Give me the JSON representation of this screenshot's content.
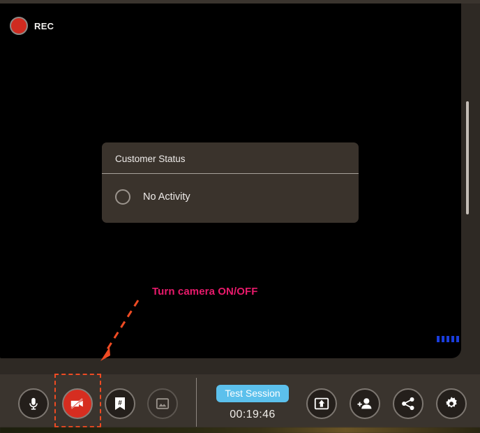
{
  "recording": {
    "label": "REC",
    "dot_color": "#cf2b20",
    "active": true
  },
  "status_card": {
    "title": "Customer Status",
    "items": [
      {
        "label": "No Activity",
        "selected": false
      }
    ]
  },
  "audio_meter": {
    "bar_count": 5,
    "color": "#1a3ddd"
  },
  "annotation": {
    "text": "Turn camera ON/OFF",
    "text_color": "#e81a6b",
    "arrow_color": "#ef4b23",
    "highlight_color": "#ef4b23"
  },
  "toolbar": {
    "left_buttons": [
      {
        "name": "microphone-button",
        "icon": "microphone-icon",
        "state": "on"
      },
      {
        "name": "camera-button",
        "icon": "camera-off-icon",
        "state": "off"
      },
      {
        "name": "bookmark-button",
        "icon": "bookmark-hash-icon",
        "state": "on"
      },
      {
        "name": "snapshot-button",
        "icon": "image-icon",
        "state": "disabled"
      }
    ],
    "session": {
      "badge_label": "Test Session",
      "badge_color": "#5cc0ec",
      "timer": "00:19:46"
    },
    "right_buttons": [
      {
        "name": "screen-share-button",
        "icon": "screen-share-icon",
        "state": "on"
      },
      {
        "name": "add-participant-button",
        "icon": "add-person-icon",
        "state": "on"
      },
      {
        "name": "share-link-button",
        "icon": "share-nodes-icon",
        "state": "on"
      },
      {
        "name": "settings-button",
        "icon": "gear-icon",
        "state": "on"
      }
    ]
  }
}
